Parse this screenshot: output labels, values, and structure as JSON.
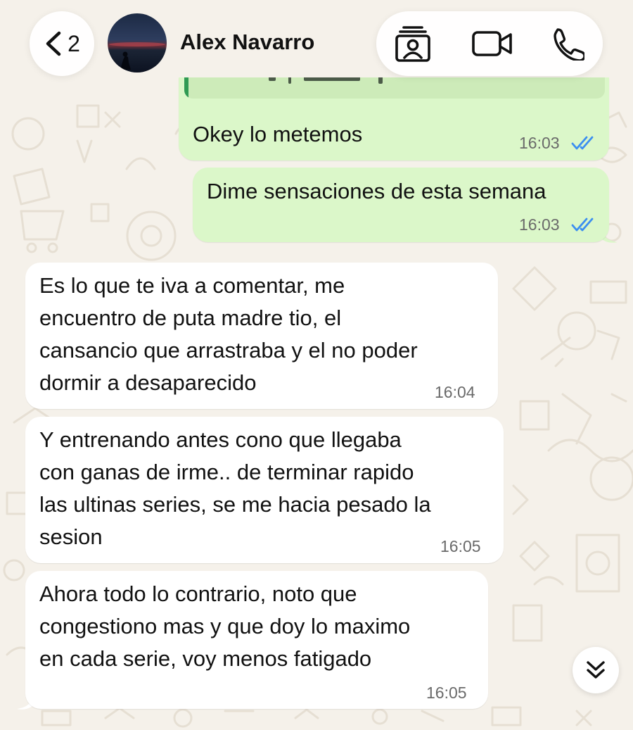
{
  "header": {
    "back_count": "2",
    "contact_name": "Alex Navarro",
    "icons": {
      "back": "chevron-left-icon",
      "contact_card": "contact-card-icon",
      "video": "video-camera-icon",
      "call": "phone-icon"
    }
  },
  "messages": [
    {
      "direction": "outgoing",
      "lines": [
        "Okey lo metemos"
      ],
      "time": "16:03",
      "read": true,
      "has_quoted_reply": true
    },
    {
      "direction": "outgoing",
      "lines": [
        "Dime sensaciones de esta semana"
      ],
      "time": "16:03",
      "read": true
    },
    {
      "direction": "incoming",
      "lines": [
        "Es lo que te iva a comentar, me",
        "encuentro de puta madre tio, el",
        "cansancio que arrastraba y el no poder",
        "dormir a desaparecido"
      ],
      "time": "16:04"
    },
    {
      "direction": "incoming",
      "lines": [
        "Y entrenando antes cono que llegaba",
        "con ganas de irme.. de terminar rapido",
        "las ultinas series, se me hacia pesado la",
        "sesion"
      ],
      "time": "16:05"
    },
    {
      "direction": "incoming",
      "lines": [
        "Ahora todo lo contrario, noto que",
        "congestiono mas y que doy lo maximo",
        "en cada serie, voy menos fatigado"
      ],
      "time": "16:05"
    }
  ],
  "scroll_button": {
    "icon": "double-chevron-down-icon"
  },
  "colors": {
    "wallpaper": "#f5f1ea",
    "outgoing_bubble": "#dbf7c9",
    "incoming_bubble": "#ffffff",
    "read_ticks": "#3b8ef0",
    "quote_bar": "#2f9a53"
  }
}
